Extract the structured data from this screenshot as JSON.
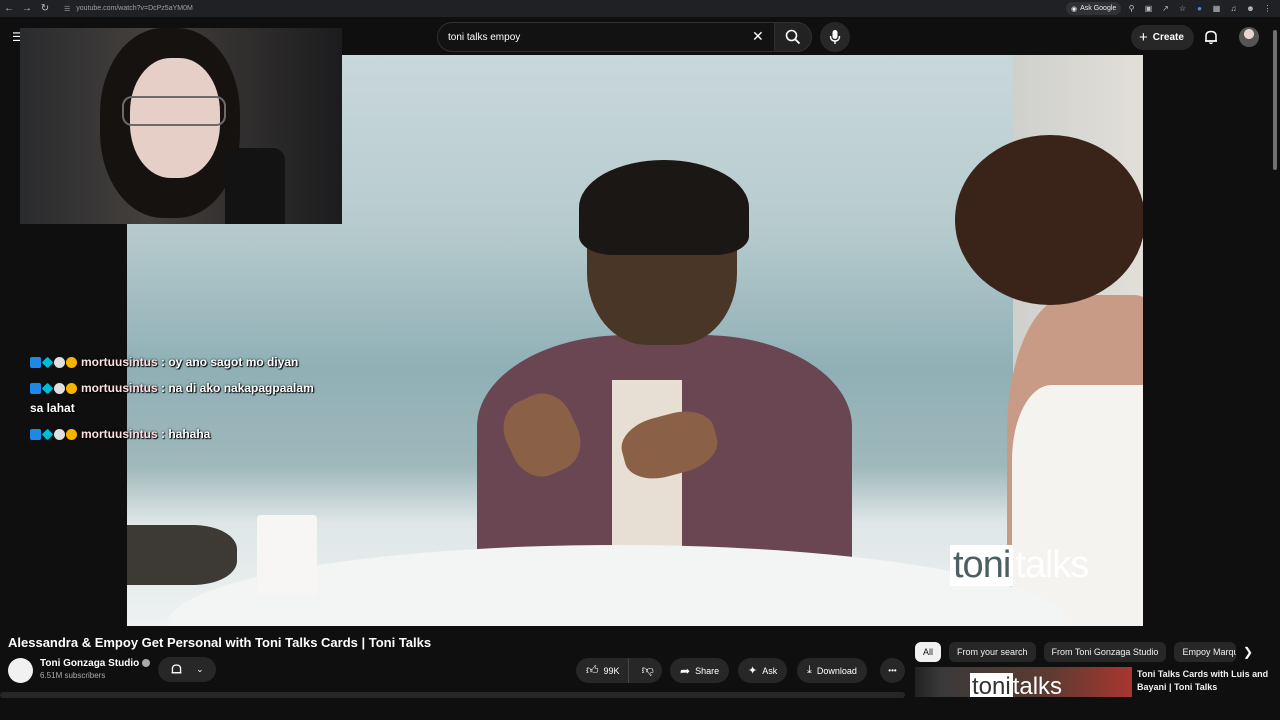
{
  "browser": {
    "url": "youtube.com/watch?v=DcPz5aYM0M",
    "ask_google": "Ask Google"
  },
  "header": {
    "search_value": "toni talks empoy",
    "create_label": "Create"
  },
  "video": {
    "watermark_toni": "toni",
    "watermark_talks": "talks"
  },
  "chat": {
    "messages": [
      {
        "user": "mortuusintus",
        "text": ": oy ano sagot mo diyan"
      },
      {
        "user": "mortuusintus",
        "text": ": na di ako nakapagpaalam sa lahat"
      },
      {
        "user": "mortuusintus",
        "text": ": hahaha"
      }
    ]
  },
  "watch": {
    "title": "Alessandra & Empoy Get Personal with Toni Talks Cards | Toni Talks",
    "channel_name": "Toni Gonzaga Studio",
    "subscribers": "6.51M subscribers",
    "likes": "99K",
    "share_label": "Share",
    "ask_label": "Ask",
    "download_label": "Download",
    "more_label": "•••"
  },
  "chips": [
    "All",
    "From your search",
    "From Toni Gonzaga Studio",
    "Empoy Marque"
  ],
  "recommendation": {
    "title": "Toni Talks Cards with Luis and Bayani | Toni Talks",
    "thumb_toni": "toni",
    "thumb_talks": "talks"
  }
}
